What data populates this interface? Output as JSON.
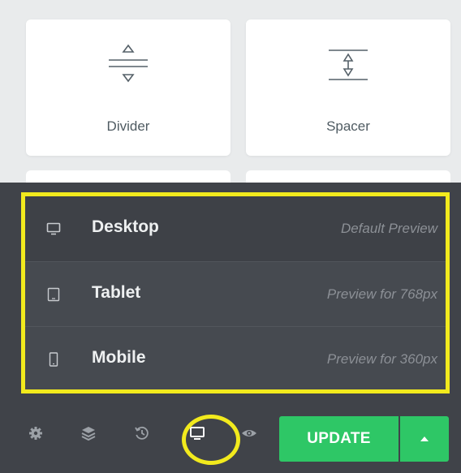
{
  "widgets": [
    {
      "label": "Divider",
      "icon": "divider-icon"
    },
    {
      "label": "Spacer",
      "icon": "spacer-icon"
    }
  ],
  "responsive_menu": {
    "items": [
      {
        "name": "Desktop",
        "description": "Default Preview",
        "icon": "desktop-icon"
      },
      {
        "name": "Tablet",
        "description": "Preview for 768px",
        "icon": "tablet-icon"
      },
      {
        "name": "Mobile",
        "description": "Preview for 360px",
        "icon": "mobile-icon"
      }
    ]
  },
  "toolbar": {
    "icons": [
      "settings-icon",
      "navigator-icon",
      "history-icon",
      "responsive-mode-icon",
      "preview-icon"
    ],
    "update_label": "UPDATE",
    "update_options_icon": "caret-up-icon"
  },
  "colors": {
    "highlight": "#f2ea1d",
    "update_green": "#2ec766",
    "panel_dark": "#404349"
  }
}
